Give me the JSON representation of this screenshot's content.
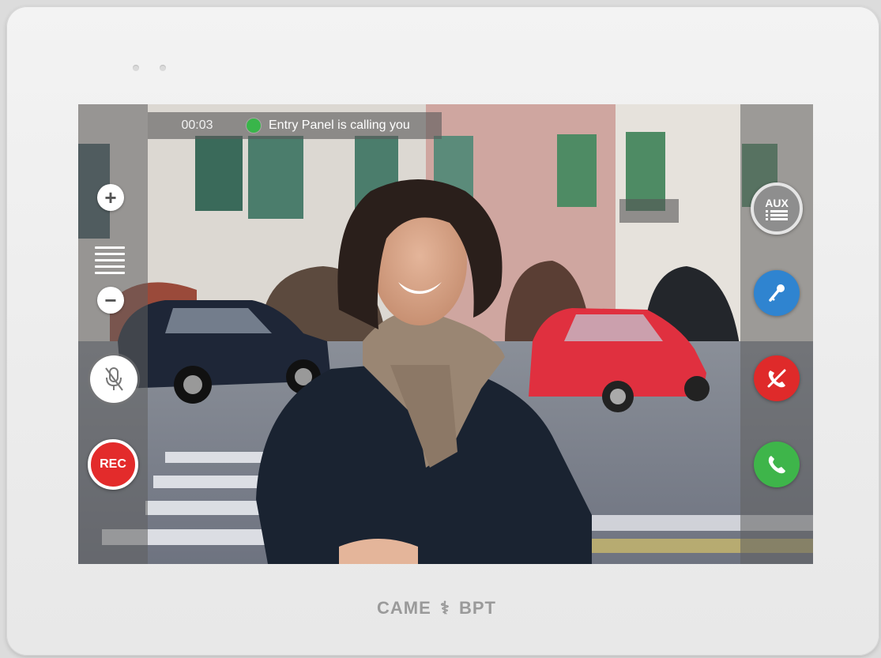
{
  "call": {
    "timer": "00:03",
    "status": "Entry Panel is calling you"
  },
  "controls": {
    "volume_up": "+",
    "volume_down": "−",
    "rec_label": "REC",
    "aux_label": "AUX"
  },
  "brand": {
    "left": "CAME",
    "symbol": "⚕",
    "right": "BPT"
  },
  "colors": {
    "status_dot": "#39b54a",
    "rec": "#e32b2b",
    "door_open": "#2f84d0",
    "mute": "#df2a2a",
    "answer": "#3eb54a"
  },
  "icons": [
    "plus-icon",
    "volume-level-icon",
    "minus-icon",
    "mic-muted-icon",
    "rec-icon",
    "aux-list-icon",
    "key-icon",
    "mute-call-icon",
    "phone-answer-icon",
    "camera-feed"
  ]
}
